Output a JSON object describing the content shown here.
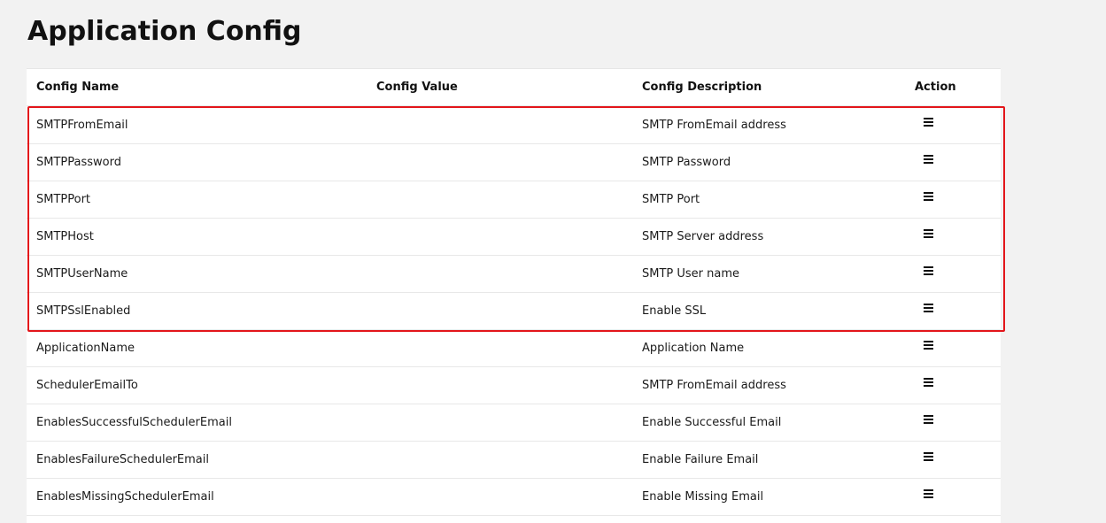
{
  "page": {
    "title": "Application Config"
  },
  "table": {
    "headers": {
      "name": "Config Name",
      "value": "Config Value",
      "description": "Config Description",
      "action": "Action"
    },
    "rows": [
      {
        "name": "SMTPFromEmail",
        "value": "",
        "description": "SMTP FromEmail address"
      },
      {
        "name": "SMTPPassword",
        "value": "",
        "description": "SMTP Password"
      },
      {
        "name": "SMTPPort",
        "value": "",
        "description": "SMTP Port"
      },
      {
        "name": "SMTPHost",
        "value": "",
        "description": "SMTP Server address"
      },
      {
        "name": "SMTPUserName",
        "value": "",
        "description": "SMTP User name"
      },
      {
        "name": "SMTPSslEnabled",
        "value": "",
        "description": "Enable SSL"
      },
      {
        "name": "ApplicationName",
        "value": "",
        "description": "Application Name"
      },
      {
        "name": "SchedulerEmailTo",
        "value": "",
        "description": "SMTP FromEmail address"
      },
      {
        "name": "EnablesSuccessfulSchedulerEmail",
        "value": "",
        "description": "Enable Successful Email"
      },
      {
        "name": "EnablesFailureSchedulerEmail",
        "value": "",
        "description": "Enable Failure Email"
      },
      {
        "name": "EnablesMissingSchedulerEmail",
        "value": "",
        "description": "Enable Missing Email"
      }
    ],
    "action_icon": "menu-icon"
  },
  "colors": {
    "background": "#f2f2f2",
    "table_background": "#ffffff",
    "highlight_border": "#e3161b"
  }
}
